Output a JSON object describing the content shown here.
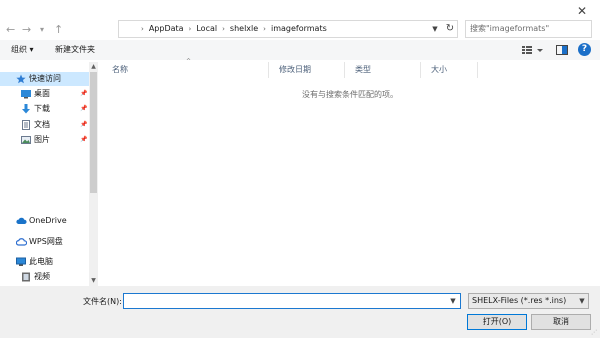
{
  "window": {
    "close_glyph": "✕"
  },
  "address": {
    "crumbs": [
      "AppData",
      "Local",
      "shelxle",
      "imageformats"
    ],
    "separator": "›",
    "search_placeholder": "搜索\"imageformats\""
  },
  "toolbar": {
    "organize_label": "组织 ▾",
    "new_folder_label": "新建文件夹"
  },
  "nav": {
    "items": [
      {
        "label": "快速访问",
        "icon": "star-icon"
      },
      {
        "label": "桌面",
        "icon": "desktop-icon"
      },
      {
        "label": "下载",
        "icon": "download-icon"
      },
      {
        "label": "文档",
        "icon": "document-icon"
      },
      {
        "label": "图片",
        "icon": "pictures-icon"
      },
      {
        "label": "OneDrive",
        "icon": "cloud-icon"
      },
      {
        "label": "WPS网盘",
        "icon": "wps-cloud-icon"
      },
      {
        "label": "此电脑",
        "icon": "computer-icon"
      },
      {
        "label": "视频",
        "icon": "video-icon"
      }
    ]
  },
  "columns": [
    "名称",
    "修改日期",
    "类型",
    "大小"
  ],
  "empty_message": "没有与搜索条件匹配的项。",
  "footer": {
    "filename_label": "文件名(N):",
    "filename_value": "",
    "filter_selected": "SHELX-Files (*.res *.ins)",
    "open_label": "打开(O)",
    "cancel_label": "取消"
  },
  "colors": {
    "accent": "#0078d7",
    "selected": "#cce8ff",
    "header_text": "#4c607a"
  }
}
